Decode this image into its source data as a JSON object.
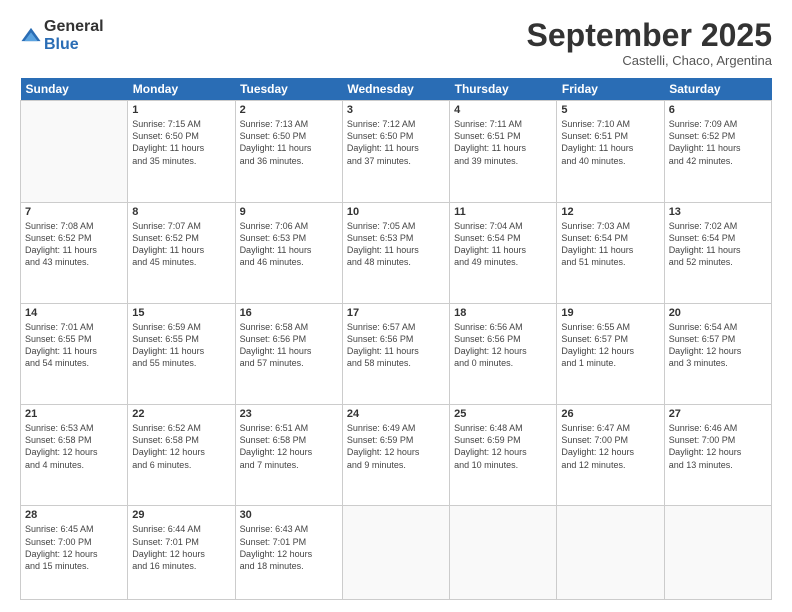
{
  "logo": {
    "general": "General",
    "blue": "Blue"
  },
  "title": "September 2025",
  "subtitle": "Castelli, Chaco, Argentina",
  "headers": [
    "Sunday",
    "Monday",
    "Tuesday",
    "Wednesday",
    "Thursday",
    "Friday",
    "Saturday"
  ],
  "weeks": [
    [
      {
        "date": "",
        "info": ""
      },
      {
        "date": "1",
        "info": "Sunrise: 7:15 AM\nSunset: 6:50 PM\nDaylight: 11 hours\nand 35 minutes."
      },
      {
        "date": "2",
        "info": "Sunrise: 7:13 AM\nSunset: 6:50 PM\nDaylight: 11 hours\nand 36 minutes."
      },
      {
        "date": "3",
        "info": "Sunrise: 7:12 AM\nSunset: 6:50 PM\nDaylight: 11 hours\nand 37 minutes."
      },
      {
        "date": "4",
        "info": "Sunrise: 7:11 AM\nSunset: 6:51 PM\nDaylight: 11 hours\nand 39 minutes."
      },
      {
        "date": "5",
        "info": "Sunrise: 7:10 AM\nSunset: 6:51 PM\nDaylight: 11 hours\nand 40 minutes."
      },
      {
        "date": "6",
        "info": "Sunrise: 7:09 AM\nSunset: 6:52 PM\nDaylight: 11 hours\nand 42 minutes."
      }
    ],
    [
      {
        "date": "7",
        "info": "Sunrise: 7:08 AM\nSunset: 6:52 PM\nDaylight: 11 hours\nand 43 minutes."
      },
      {
        "date": "8",
        "info": "Sunrise: 7:07 AM\nSunset: 6:52 PM\nDaylight: 11 hours\nand 45 minutes."
      },
      {
        "date": "9",
        "info": "Sunrise: 7:06 AM\nSunset: 6:53 PM\nDaylight: 11 hours\nand 46 minutes."
      },
      {
        "date": "10",
        "info": "Sunrise: 7:05 AM\nSunset: 6:53 PM\nDaylight: 11 hours\nand 48 minutes."
      },
      {
        "date": "11",
        "info": "Sunrise: 7:04 AM\nSunset: 6:54 PM\nDaylight: 11 hours\nand 49 minutes."
      },
      {
        "date": "12",
        "info": "Sunrise: 7:03 AM\nSunset: 6:54 PM\nDaylight: 11 hours\nand 51 minutes."
      },
      {
        "date": "13",
        "info": "Sunrise: 7:02 AM\nSunset: 6:54 PM\nDaylight: 11 hours\nand 52 minutes."
      }
    ],
    [
      {
        "date": "14",
        "info": "Sunrise: 7:01 AM\nSunset: 6:55 PM\nDaylight: 11 hours\nand 54 minutes."
      },
      {
        "date": "15",
        "info": "Sunrise: 6:59 AM\nSunset: 6:55 PM\nDaylight: 11 hours\nand 55 minutes."
      },
      {
        "date": "16",
        "info": "Sunrise: 6:58 AM\nSunset: 6:56 PM\nDaylight: 11 hours\nand 57 minutes."
      },
      {
        "date": "17",
        "info": "Sunrise: 6:57 AM\nSunset: 6:56 PM\nDaylight: 11 hours\nand 58 minutes."
      },
      {
        "date": "18",
        "info": "Sunrise: 6:56 AM\nSunset: 6:56 PM\nDaylight: 12 hours\nand 0 minutes."
      },
      {
        "date": "19",
        "info": "Sunrise: 6:55 AM\nSunset: 6:57 PM\nDaylight: 12 hours\nand 1 minute."
      },
      {
        "date": "20",
        "info": "Sunrise: 6:54 AM\nSunset: 6:57 PM\nDaylight: 12 hours\nand 3 minutes."
      }
    ],
    [
      {
        "date": "21",
        "info": "Sunrise: 6:53 AM\nSunset: 6:58 PM\nDaylight: 12 hours\nand 4 minutes."
      },
      {
        "date": "22",
        "info": "Sunrise: 6:52 AM\nSunset: 6:58 PM\nDaylight: 12 hours\nand 6 minutes."
      },
      {
        "date": "23",
        "info": "Sunrise: 6:51 AM\nSunset: 6:58 PM\nDaylight: 12 hours\nand 7 minutes."
      },
      {
        "date": "24",
        "info": "Sunrise: 6:49 AM\nSunset: 6:59 PM\nDaylight: 12 hours\nand 9 minutes."
      },
      {
        "date": "25",
        "info": "Sunrise: 6:48 AM\nSunset: 6:59 PM\nDaylight: 12 hours\nand 10 minutes."
      },
      {
        "date": "26",
        "info": "Sunrise: 6:47 AM\nSunset: 7:00 PM\nDaylight: 12 hours\nand 12 minutes."
      },
      {
        "date": "27",
        "info": "Sunrise: 6:46 AM\nSunset: 7:00 PM\nDaylight: 12 hours\nand 13 minutes."
      }
    ],
    [
      {
        "date": "28",
        "info": "Sunrise: 6:45 AM\nSunset: 7:00 PM\nDaylight: 12 hours\nand 15 minutes."
      },
      {
        "date": "29",
        "info": "Sunrise: 6:44 AM\nSunset: 7:01 PM\nDaylight: 12 hours\nand 16 minutes."
      },
      {
        "date": "30",
        "info": "Sunrise: 6:43 AM\nSunset: 7:01 PM\nDaylight: 12 hours\nand 18 minutes."
      },
      {
        "date": "",
        "info": ""
      },
      {
        "date": "",
        "info": ""
      },
      {
        "date": "",
        "info": ""
      },
      {
        "date": "",
        "info": ""
      }
    ]
  ]
}
